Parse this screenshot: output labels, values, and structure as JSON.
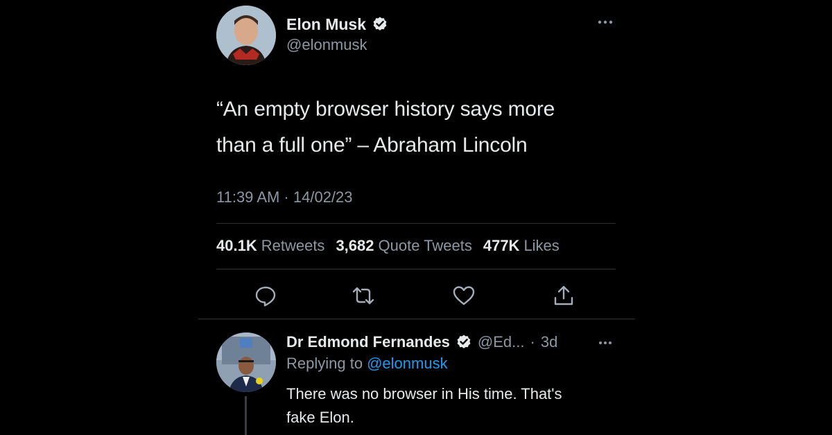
{
  "main_tweet": {
    "display_name": "Elon Musk",
    "handle": "@elonmusk",
    "text_line_1": "“An empty browser history says more",
    "text_line_2": "than a full one” – Abraham Lincoln",
    "timestamp": "11:39 AM · 14/02/23",
    "stats": {
      "retweets_count": "40.1K",
      "retweets_label": "Retweets",
      "quotes_count": "3,682",
      "quotes_label": "Quote Tweets",
      "likes_count": "477K",
      "likes_label": "Likes"
    },
    "verified": true
  },
  "reply_tweet": {
    "display_name": "Dr Edmond Fernandes",
    "handle": "@Ed...",
    "dot": "·",
    "age": "3d",
    "replying_prefix": "Replying to",
    "replying_mention": "@elonmusk",
    "text_line_1": "There was no browser in His time. That's",
    "text_line_2": "fake Elon.",
    "verified": true
  },
  "icons": [
    "more-icon",
    "verified-icon",
    "reply-icon",
    "retweet-icon",
    "like-icon",
    "share-icon"
  ],
  "colors": {
    "background": "#000000",
    "primary_text": "#e7e9ea",
    "secondary_text": "#8b98a5",
    "link": "#1d9bf0",
    "divider": "#2f3336"
  }
}
